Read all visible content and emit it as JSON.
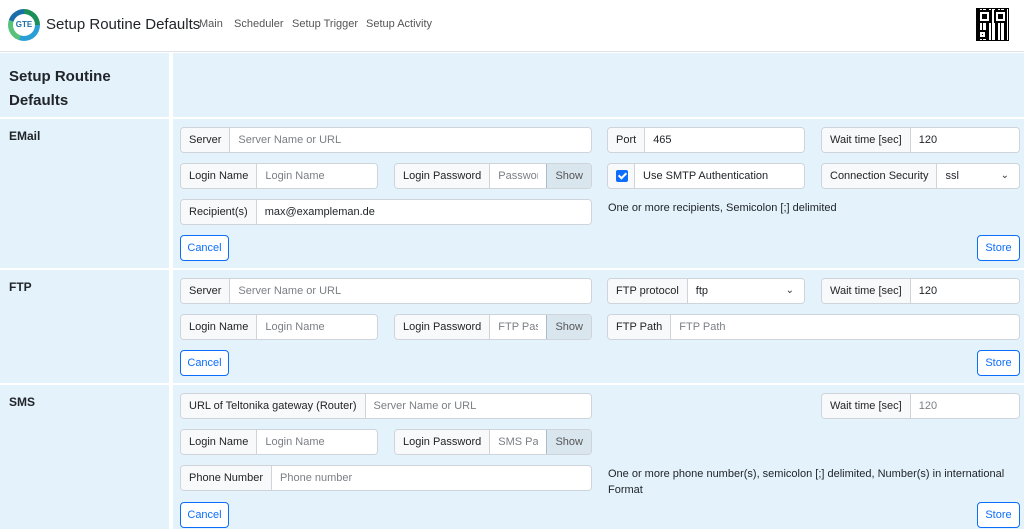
{
  "header": {
    "logo_text": "GTE",
    "title": "Setup Routine Defaults",
    "nav": [
      "Main",
      "Scheduler",
      "Setup Trigger",
      "Setup Activity"
    ]
  },
  "page_title": "Setup Routine Defaults",
  "email": {
    "section_label": "EMail",
    "server_label": "Server",
    "server_placeholder": "Server Name or URL",
    "port_label": "Port",
    "port_value": "465",
    "wait_label": "Wait time [sec]",
    "wait_value": "120",
    "login_label": "Login Name",
    "login_placeholder": "Login Name",
    "password_label": "Login Password",
    "password_placeholder": "Password",
    "show_label": "Show",
    "smtp_auth_label": "Use SMTP Authentication",
    "smtp_auth_checked": true,
    "security_label": "Connection Security",
    "security_value": "ssl",
    "recipients_label": "Recipient(s)",
    "recipients_value": "max@exampleman.de",
    "recipients_hint": "One or more recipients, Semicolon [;] delimited",
    "cancel_label": "Cancel",
    "store_label": "Store"
  },
  "ftp": {
    "section_label": "FTP",
    "server_label": "Server",
    "server_placeholder": "Server Name or URL",
    "protocol_label": "FTP protocol",
    "protocol_value": "ftp",
    "wait_label": "Wait time [sec]",
    "wait_value": "120",
    "login_label": "Login Name",
    "login_placeholder": "Login Name",
    "password_label": "Login Password",
    "password_placeholder": "FTP Passw",
    "show_label": "Show",
    "path_label": "FTP Path",
    "path_placeholder": "FTP Path",
    "cancel_label": "Cancel",
    "store_label": "Store"
  },
  "sms": {
    "section_label": "SMS",
    "gateway_label": "URL of Teltonika gateway (Router)",
    "gateway_placeholder": "Server Name or URL",
    "wait_label": "Wait time [sec]",
    "wait_placeholder": "120",
    "login_label": "Login Name",
    "login_placeholder": "Login Name",
    "password_label": "Login Password",
    "password_placeholder": "SMS Passv",
    "show_label": "Show",
    "phone_label": "Phone Number",
    "phone_placeholder": "Phone number",
    "phone_hint": "One or more phone number(s), semicolon [;] delimited, Number(s) in international Format",
    "cancel_label": "Cancel",
    "store_label": "Store"
  }
}
